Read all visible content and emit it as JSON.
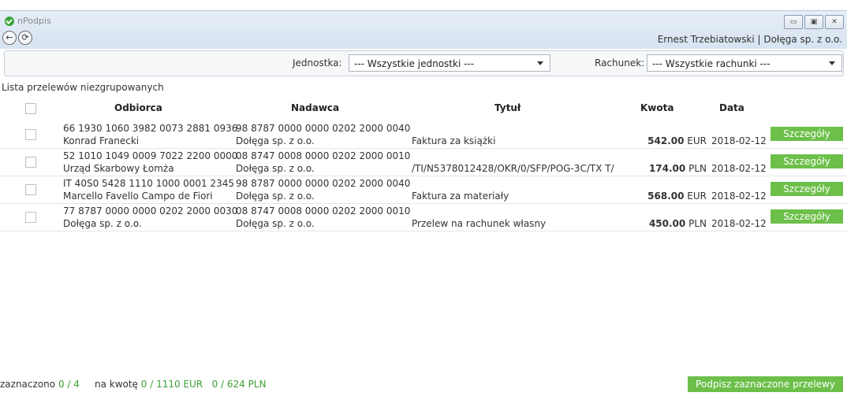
{
  "app": {
    "name": "nPodpis"
  },
  "nav": {
    "back_glyph": "←",
    "refresh_glyph": "⟳"
  },
  "window_controls": {
    "minimize": "▭",
    "maximize": "▣",
    "close": "✕"
  },
  "header": {
    "user_info": "Ernest Trzebiatowski  |  Dołęga sp. z o.o."
  },
  "filters": {
    "unit_label": "Jednostka:",
    "unit_value": "--- Wszystkie jednostki ---",
    "account_label": "Rachunek:",
    "account_value": "--- Wszystkie rachunki ---"
  },
  "list": {
    "title": "Lista przelewów niezgrupowanych",
    "columns": {
      "recipient": "Odbiorca",
      "sender": "Nadawca",
      "title": "Tytuł",
      "amount": "Kwota",
      "date": "Data"
    },
    "details_label": "Szczegóły",
    "rows": [
      {
        "recipient_account": "66 1930 1060 3982 0073 2881 0936",
        "recipient_name": "Konrad Franecki",
        "sender_account": "98 8787 0000 0000 0202 2000 0040",
        "sender_name": "Dołęga sp. z o.o.",
        "title": "Faktura za książki",
        "amount": "542.00",
        "currency": "EUR",
        "date": "2018-02-12"
      },
      {
        "recipient_account": "52 1010 1049 0009 7022 2200 0000",
        "recipient_name": "Urząd Skarbowy Łomża",
        "sender_account": "08 8747 0008 0000 0202 2000 0010",
        "sender_name": "Dołęga sp. z o.o.",
        "title": "/TI/N5378012428/OKR/0/SFP/POG-3C/TX T/",
        "amount": "174.00",
        "currency": "PLN",
        "date": "2018-02-12"
      },
      {
        "recipient_account": "IT 40S0 5428 1110 1000 0001 2345",
        "recipient_name": "Marcello Favello Campo de Fiori",
        "sender_account": "98 8787 0000 0000 0202 2000 0040",
        "sender_name": "Dołęga sp. z o.o.",
        "title": "Faktura za materiały",
        "amount": "568.00",
        "currency": "EUR",
        "date": "2018-02-12"
      },
      {
        "recipient_account": "77 8787 0000 0000 0202 2000 0030",
        "recipient_name": "Dołęga sp. z o.o.",
        "sender_account": "08 8747 0008 0000 0202 2000 0010",
        "sender_name": "Dołęga sp. z o.o.",
        "title": "Przelew na rachunek własny",
        "amount": "450.00",
        "currency": "PLN",
        "date": "2018-02-12"
      }
    ]
  },
  "footer": {
    "selected_label": "zaznaczono",
    "selected_value": "0 / 4",
    "amount_label": "na kwotę",
    "amount_eur": "0 / 1110 EUR",
    "amount_pln": "0 / 624 PLN",
    "sign_button": "Podpisz zaznaczone przelewy"
  },
  "colors": {
    "accent_green": "#6cc04a",
    "text_green": "#3ba135"
  }
}
